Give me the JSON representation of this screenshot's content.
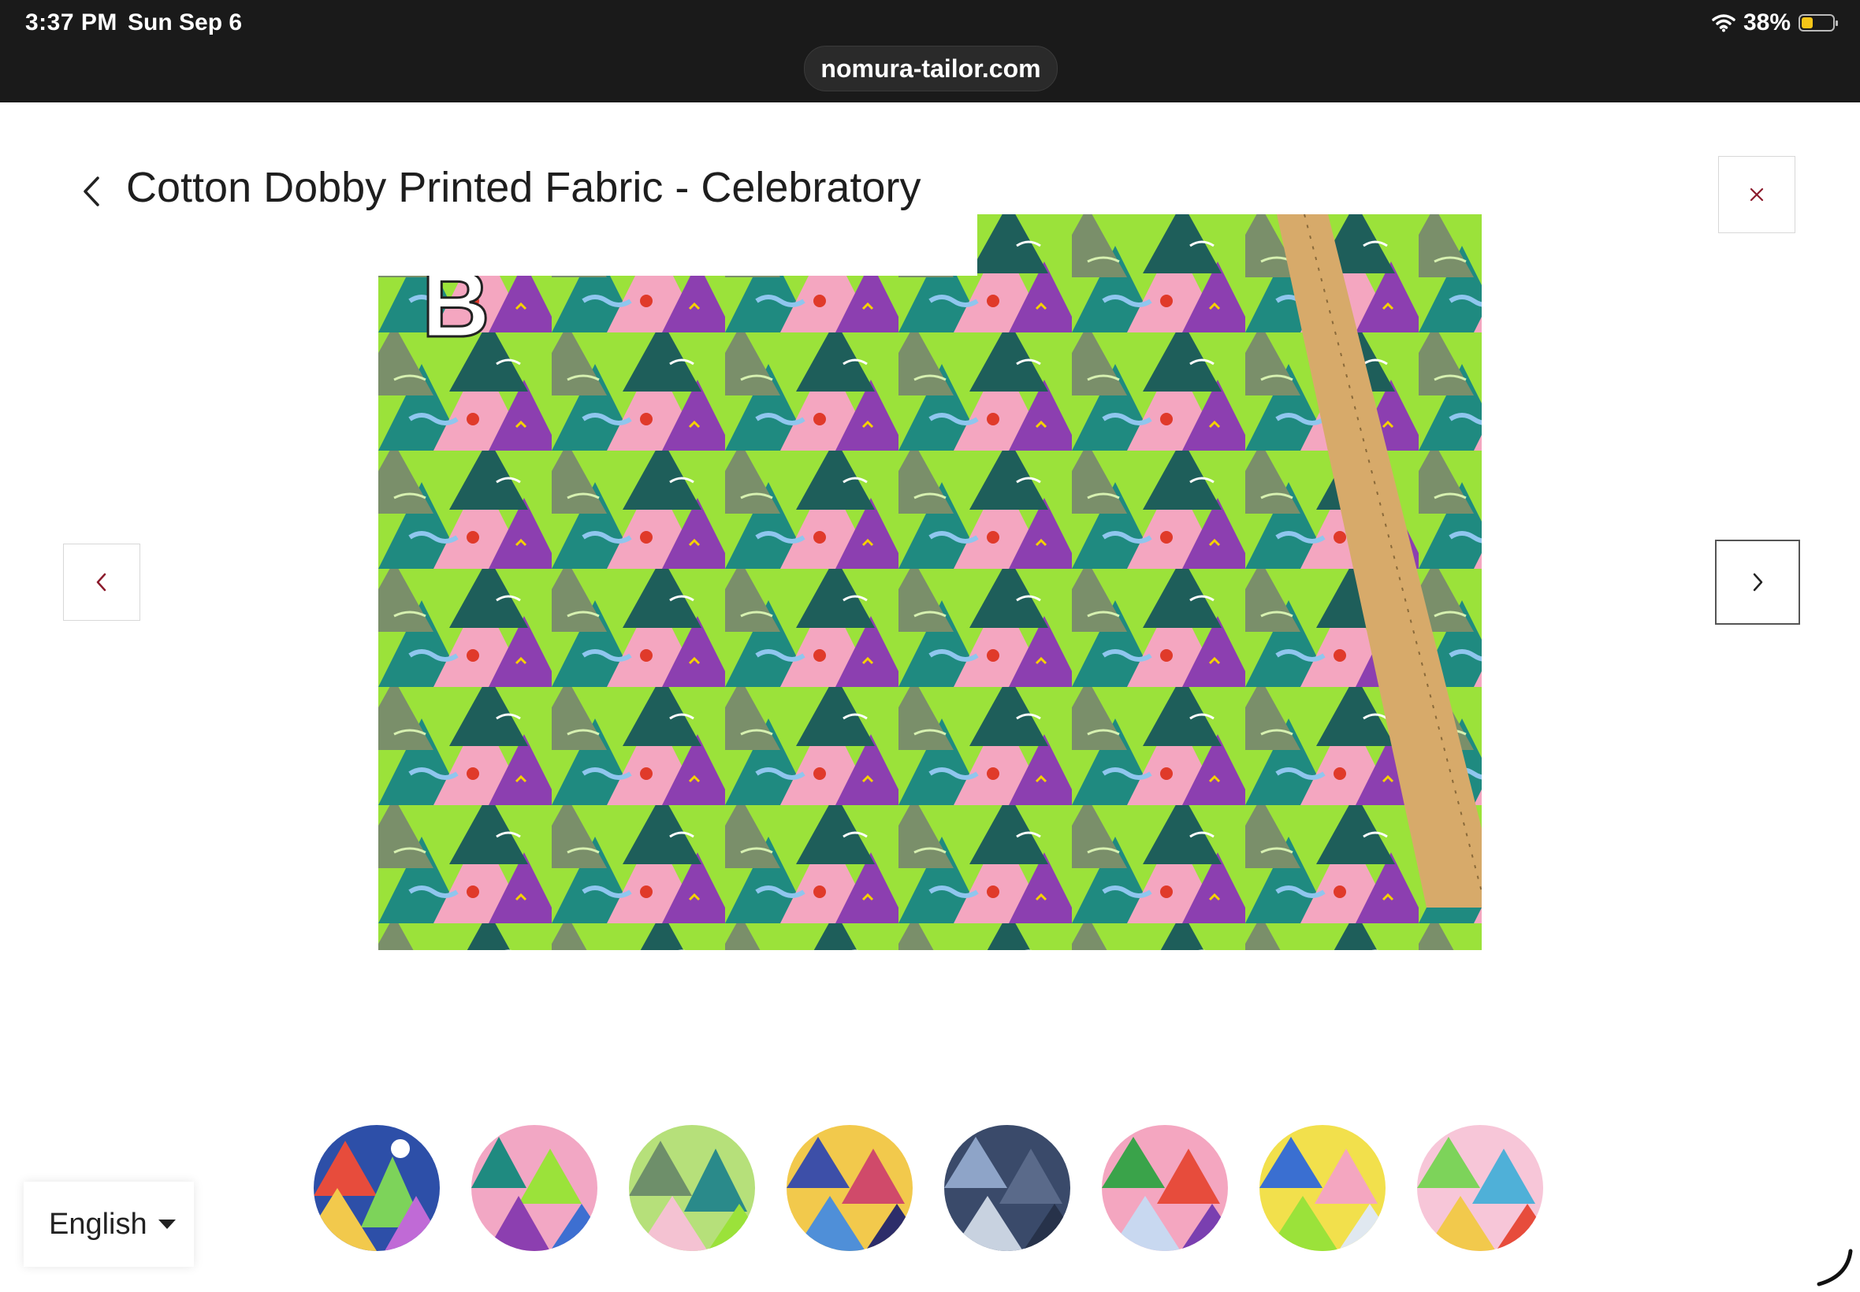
{
  "status_bar": {
    "time": "3:37 PM",
    "date": "Sun Sep 6",
    "battery_percent": "38%",
    "battery_level": 0.38,
    "battery_color": "#f5c518"
  },
  "browser": {
    "url": "nomura-tailor.com"
  },
  "product": {
    "title": "Cotton Dobby Printed Fabric - Celebratory"
  },
  "image": {
    "corner_label": "B"
  },
  "controls": {
    "back_icon": "chevron-left-icon",
    "close_icon": "close-icon",
    "prev_icon": "chevron-left-icon",
    "next_icon": "chevron-right-icon",
    "accent_color": "#8b1a2b"
  },
  "thumbnails": [
    {
      "name": "thumbnail-1"
    },
    {
      "name": "thumbnail-2"
    },
    {
      "name": "thumbnail-3"
    },
    {
      "name": "thumbnail-4"
    },
    {
      "name": "thumbnail-5"
    },
    {
      "name": "thumbnail-6"
    },
    {
      "name": "thumbnail-7"
    },
    {
      "name": "thumbnail-8"
    }
  ],
  "language": {
    "selected": "English"
  }
}
